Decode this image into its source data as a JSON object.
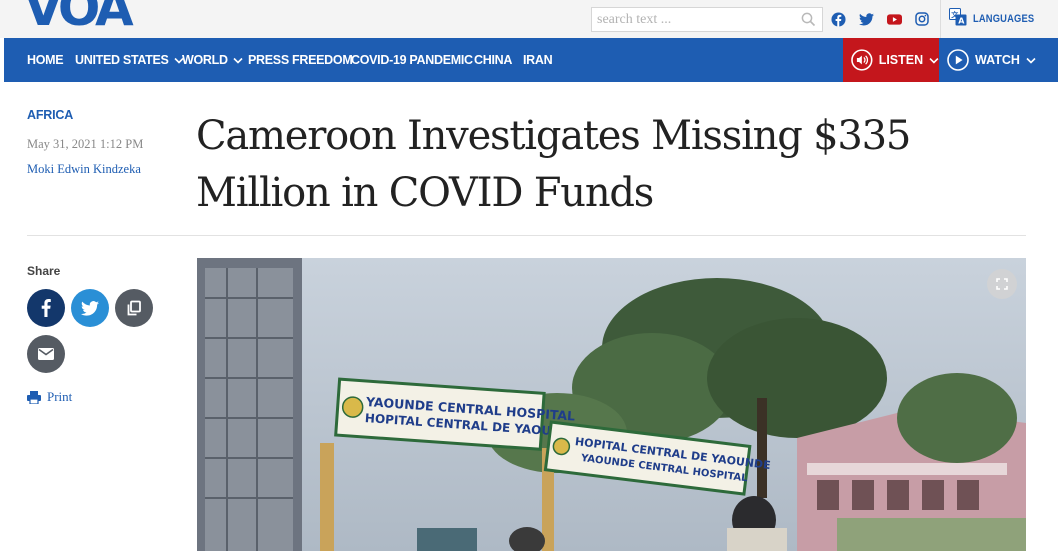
{
  "brand": {
    "logo_text": "VOA",
    "accent": "#1e5db2",
    "listen_bg": "#c4161c"
  },
  "search": {
    "placeholder": "search text ..."
  },
  "social_icons": [
    "facebook-icon",
    "twitter-icon",
    "youtube-icon",
    "instagram-icon"
  ],
  "languages_label": "LANGUAGES",
  "nav": {
    "items": [
      "HOME",
      "UNITED STATES",
      "WORLD",
      "PRESS FREEDOM",
      "COVID-19 PANDEMIC",
      "CHINA",
      "IRAN"
    ],
    "listen_label": "LISTEN",
    "watch_label": "WATCH"
  },
  "article": {
    "category": "AFRICA",
    "date": "May 31, 2021 1:12 PM",
    "author": "Moki Edwin Kindzeka",
    "headline": "Cameroon Investigates Missing $335 Million in COVID Funds"
  },
  "share": {
    "label": "Share",
    "buttons": [
      "facebook-icon",
      "twitter-icon",
      "copy-link-icon",
      "email-icon"
    ],
    "print_label": "Print"
  },
  "photo": {
    "sign_front_line1": "YAOUNDE CENTRAL HOSPITAL",
    "sign_front_line2": "HOPITAL CENTRAL DE YAOUNDE",
    "sign_back_line1": "HOPITAL CENTRAL DE YAOUNDE",
    "sign_back_line2": "YAOUNDE CENTRAL HOSPITAL"
  }
}
